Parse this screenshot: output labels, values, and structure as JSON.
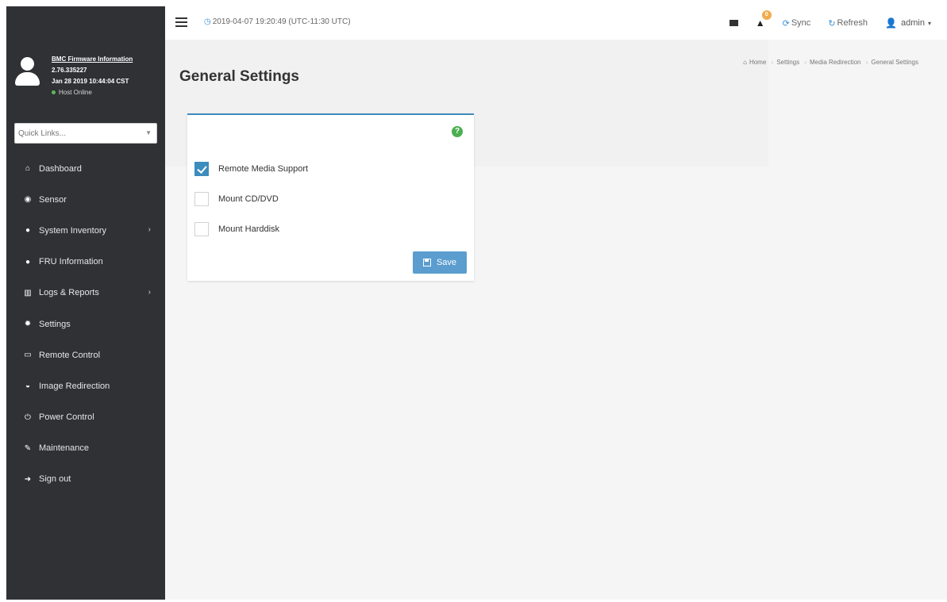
{
  "sidebar": {
    "firmware_title": "BMC Firmware Information",
    "firmware_version": "2.76.335227",
    "firmware_date": "Jan 28 2019 10:44:04 CST",
    "host_status": "Host Online",
    "quick_links_placeholder": "Quick Links...",
    "items": [
      {
        "label": "Dashboard",
        "icon": "dashboard-icon"
      },
      {
        "label": "Sensor",
        "icon": "sensor-icon"
      },
      {
        "label": "System Inventory",
        "icon": "info-icon",
        "has_submenu": true
      },
      {
        "label": "FRU Information",
        "icon": "info-icon"
      },
      {
        "label": "Logs & Reports",
        "icon": "chart-icon",
        "has_submenu": true
      },
      {
        "label": "Settings",
        "icon": "gear-icon"
      },
      {
        "label": "Remote Control",
        "icon": "monitor-icon"
      },
      {
        "label": "Image Redirection",
        "icon": "disc-icon"
      },
      {
        "label": "Power Control",
        "icon": "power-icon"
      },
      {
        "label": "Maintenance",
        "icon": "wrench-icon"
      },
      {
        "label": "Sign out",
        "icon": "sign-out-icon"
      }
    ]
  },
  "header": {
    "datetime": "2019-04-07 19:20:49 (UTC-11:30 UTC)",
    "alert_count": "0",
    "sync_label": "Sync",
    "refresh_label": "Refresh",
    "user_label": "admin"
  },
  "main": {
    "title": "General Settings",
    "breadcrumb": [
      "Home",
      "Settings",
      "Media Redirection",
      "General Settings"
    ],
    "form": {
      "options": [
        {
          "label": "Remote Media Support",
          "checked": true
        },
        {
          "label": "Mount CD/DVD",
          "checked": false
        },
        {
          "label": "Mount Harddisk",
          "checked": false
        }
      ],
      "save_label": "Save"
    }
  },
  "colors": {
    "sidebar_bg": "#2f3135",
    "accent": "#3c8dbc",
    "save_button": "#5b9dcf",
    "help_icon": "#4caf50",
    "alert_badge": "#f0ad4e"
  }
}
